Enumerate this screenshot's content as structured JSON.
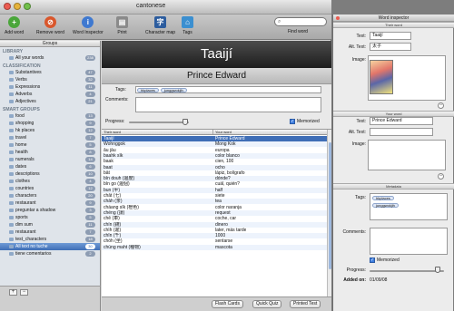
{
  "window": {
    "title": "cantonese"
  },
  "toolbar": {
    "add_word": "Add word",
    "remove": "Remove word",
    "inspector": "Word Inspector",
    "print": "Print",
    "charmap": "Character map",
    "tags": "Tags",
    "find": "Find word"
  },
  "sidebar": {
    "header": "Groups",
    "library_label": "LIBRARY",
    "library": [
      {
        "label": "All your words",
        "count": "238"
      }
    ],
    "classification_label": "CLASSIFICATION",
    "classification": [
      {
        "label": "Substantives",
        "count": "47"
      },
      {
        "label": "Verbs",
        "count": "32"
      },
      {
        "label": "Expressions",
        "count": "11"
      },
      {
        "label": "Adverbs",
        "count": "4"
      },
      {
        "label": "Adjectives",
        "count": "21"
      }
    ],
    "smart_label": "SMART GROUPS",
    "smart": [
      {
        "label": "food",
        "count": "13"
      },
      {
        "label": "shopping",
        "count": "9"
      },
      {
        "label": "hk places",
        "count": "12"
      },
      {
        "label": "travel",
        "count": "7"
      },
      {
        "label": "home",
        "count": "5"
      },
      {
        "label": "health",
        "count": "8"
      },
      {
        "label": "numerals",
        "count": "14"
      },
      {
        "label": "dates",
        "count": "6"
      },
      {
        "label": "descriptions",
        "count": "10"
      },
      {
        "label": "clothes",
        "count": "4"
      },
      {
        "label": "countries",
        "count": "12"
      },
      {
        "label": "characters",
        "count": "20"
      },
      {
        "label": "restaurant",
        "count": "9"
      },
      {
        "label": "preguntar a shadow",
        "count": "3"
      },
      {
        "label": "sports",
        "count": "5"
      },
      {
        "label": "dim sum",
        "count": "11"
      },
      {
        "label": "restaurant",
        "count": "7"
      },
      {
        "label": "test_characters",
        "count": "18"
      },
      {
        "label": "All text no tuche",
        "count": "30"
      },
      {
        "label": "tiene comentarios",
        "count": "2"
      }
    ],
    "add_button": "+",
    "remove_button": "−"
  },
  "main": {
    "word": "Taaijí",
    "translation": "Prince Edward",
    "tags_label": "Tags:",
    "tags": [
      "hkplaces",
      "junggwokjih"
    ],
    "comments_label": "Comments:",
    "progress_label": "Progress:",
    "progress": 0.9,
    "memorized_label": "Memorized",
    "memorized": true,
    "table": {
      "columns": [
        "Their word",
        "Your word"
      ],
      "rows": [
        [
          "Taaijí",
          "Prince Edward"
        ],
        [
          "Wohnggok",
          "Mong Kok"
        ],
        [
          "âu jāu",
          "europa"
        ],
        [
          "baahk sīk",
          "color blanco"
        ],
        [
          "baak",
          "cien, 100"
        ],
        [
          "baat",
          "ocho"
        ],
        [
          "bāt",
          "lápiz, bolígrafo"
        ],
        [
          "bīn douh (邊度)",
          "dónde?"
        ],
        [
          "bīn go (邊個)",
          "cuál, quién?"
        ],
        [
          "bun (半)",
          "half"
        ],
        [
          "chāt (七)",
          "siete"
        ],
        [
          "chàh (茶)",
          "tea"
        ],
        [
          "cháang sīk (橙色)",
          "color naranja"
        ],
        [
          "chéng (請)",
          "request"
        ],
        [
          "chē (車)",
          "coche, car"
        ],
        [
          "chín (錢)",
          "dinero"
        ],
        [
          "chìh (遲)",
          "later, más tarde"
        ],
        [
          "chīn (千)",
          "1000"
        ],
        [
          "chóh (坐)",
          "sentarse"
        ],
        [
          "chúng maht (種物)",
          "mascota"
        ]
      ]
    },
    "buttons": {
      "flash": "Flash Cards",
      "quiz": "Quick Quiz",
      "print": "Printed Test"
    }
  },
  "inspector": {
    "title": "Word inspector",
    "their_word_header": "Their word",
    "text_label": "Text:",
    "text_value": "Taaijí",
    "alt_label": "Alt. Text:",
    "alt_value": "太子",
    "image_label": "Image:",
    "your_word_header": "Your word",
    "your_text_label": "Text:",
    "your_text_value": "Prince Edward",
    "your_alt_label": "Alt. Text:",
    "your_image_label": "Image:",
    "metadata_header": "Metadata",
    "tags_label": "Tags:",
    "tags": [
      "hkplaces",
      "junggwokjih"
    ],
    "comments_label": "Comments:",
    "memorized_label": "Memorized",
    "progress_label": "Progress:",
    "added_label": "Added on:",
    "added_value": "01/09/08"
  },
  "colors": {
    "selection": "#3f6eb6",
    "header_bg": "#1d1d1d",
    "accent_green": "#4aa63a",
    "accent_red": "#d9572c"
  }
}
